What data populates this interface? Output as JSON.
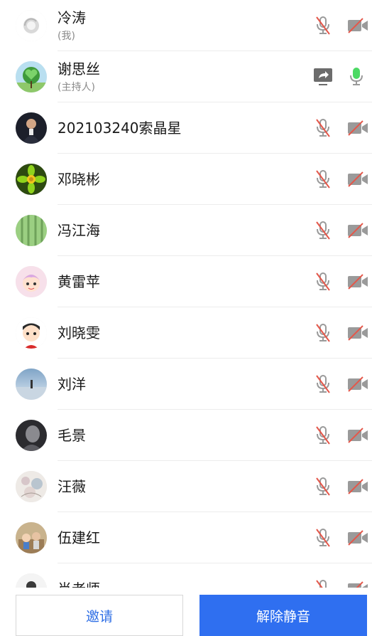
{
  "participants": [
    {
      "name": "冷涛",
      "role": "(我)",
      "mic": "mic-off-icon",
      "video": "video-off-icon"
    },
    {
      "name": "谢思丝",
      "role": "(主持人)",
      "screen_share": "screen-share-icon",
      "mic": "mic-on-icon"
    },
    {
      "name": "202103240索晶星",
      "mic": "mic-off-icon",
      "video": "video-off-icon"
    },
    {
      "name": "邓晓彬",
      "mic": "mic-off-icon",
      "video": "video-off-icon"
    },
    {
      "name": "冯江海",
      "mic": "mic-off-icon",
      "video": "video-off-icon"
    },
    {
      "name": "黄雷苹",
      "mic": "mic-off-icon",
      "video": "video-off-icon"
    },
    {
      "name": "刘晓雯",
      "mic": "mic-off-icon",
      "video": "video-off-icon"
    },
    {
      "name": "刘洋",
      "mic": "mic-off-icon",
      "video": "video-off-icon"
    },
    {
      "name": "毛景",
      "mic": "mic-off-icon",
      "video": "video-off-icon"
    },
    {
      "name": "汪薇",
      "mic": "mic-off-icon",
      "video": "video-off-icon"
    },
    {
      "name": "伍建红",
      "mic": "mic-off-icon",
      "video": "video-off-icon"
    },
    {
      "name": "肖老师",
      "mic": "mic-off-icon",
      "video": "video-off-icon"
    }
  ],
  "buttons": {
    "invite": "邀请",
    "unmute": "解除静音"
  },
  "colors": {
    "accent_blue": "#2f6ff0",
    "mic_on_green": "#4cd964",
    "mute_slash_red": "#e4574a",
    "icon_grey": "#9a9a9a"
  }
}
